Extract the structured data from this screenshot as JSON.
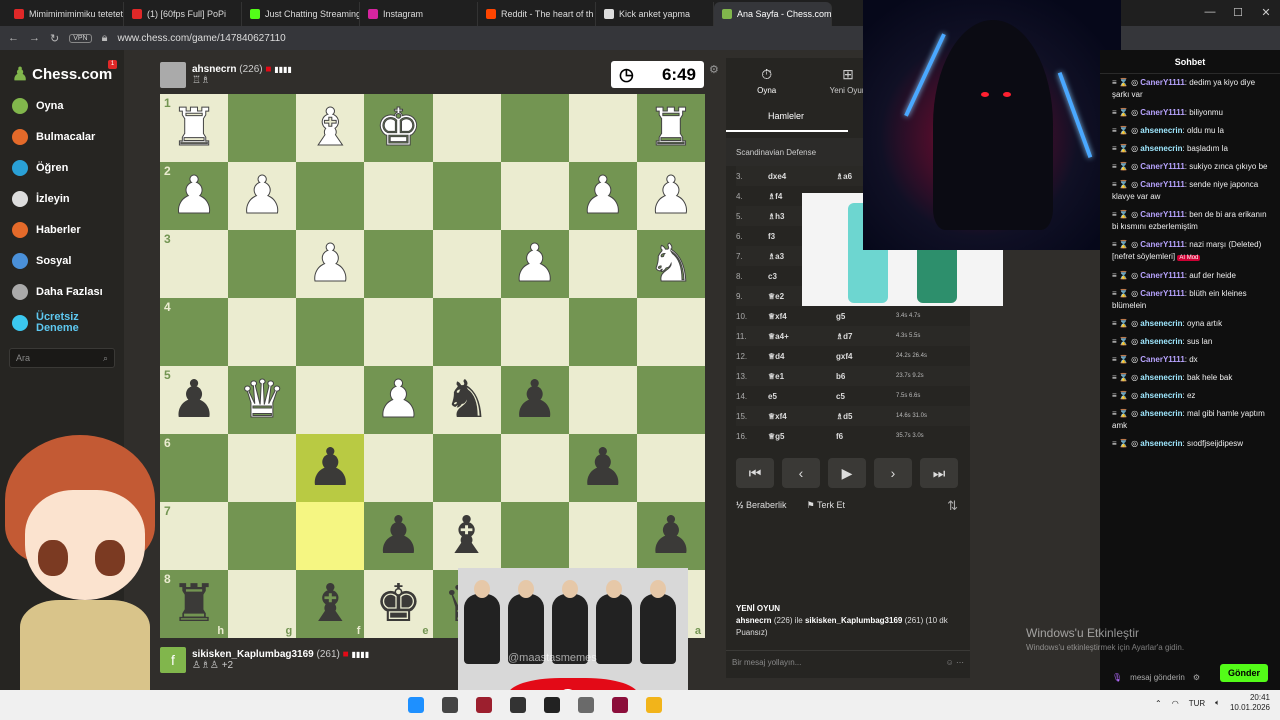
{
  "browser": {
    "tabs": [
      {
        "label": "Mimimimimimiku tetetete"
      },
      {
        "label": "(1) [60fps Full] PoPi"
      },
      {
        "label": "Just Chatting Streaming"
      },
      {
        "label": "Instagram"
      },
      {
        "label": "Reddit - The heart of th"
      },
      {
        "label": "Kick anket yapma"
      },
      {
        "label": "Ana Sayfa - Chess.com"
      }
    ],
    "url": "www.chess.com/game/147840627110",
    "vpn": "VPN",
    "kick_label": "kick."
  },
  "sidebar": {
    "logo": "Chess.com",
    "notif": "1",
    "items": [
      {
        "label": "Oyna",
        "icon": "play-icon",
        "color": "#81b64c"
      },
      {
        "label": "Bulmacalar",
        "icon": "puzzle-icon",
        "color": "#e46a2a"
      },
      {
        "label": "Öğren",
        "icon": "learn-icon",
        "color": "#2aa0d6"
      },
      {
        "label": "İzleyin",
        "icon": "watch-icon",
        "color": "#dddddd"
      },
      {
        "label": "Haberler",
        "icon": "news-icon",
        "color": "#e46a2a"
      },
      {
        "label": "Sosyal",
        "icon": "social-icon",
        "color": "#4a90d9"
      },
      {
        "label": "Daha Fazlası",
        "icon": "more-icon",
        "color": "#aaaaaa"
      },
      {
        "label": "Ücretsiz Deneme",
        "icon": "diamond-icon",
        "color": "#3bc8f0"
      }
    ],
    "search_placeholder": "Ara"
  },
  "top_player": {
    "name": "ahsnecrn",
    "rating": "(226)",
    "clock": "6:49"
  },
  "bottom_player": {
    "name": "sikisken_Kaplumbag3169",
    "rating": "(261)",
    "captured_extra": "+2",
    "badge": "f"
  },
  "board": {
    "ranks": [
      "1",
      "2",
      "3",
      "4",
      "5",
      "6",
      "7",
      "8"
    ],
    "files": [
      "h",
      "g",
      "f",
      "e",
      "d",
      "c",
      "b",
      "a"
    ]
  },
  "panel": {
    "tab_play": "Oyna",
    "tab_new": "Yeni Oyun",
    "subtab": "Hamleler",
    "opening": "Scandinavian Defense",
    "moves": [
      {
        "n": "3.",
        "w": "dxe4",
        "b": "♗a6",
        "t": ""
      },
      {
        "n": "4.",
        "w": "♗f4",
        "b": "",
        "t": ""
      },
      {
        "n": "5.",
        "w": "♗h3",
        "b": "",
        "t": ""
      },
      {
        "n": "6.",
        "w": "f3",
        "b": "",
        "t": ""
      },
      {
        "n": "7.",
        "w": "♗a3",
        "b": "",
        "t": ""
      },
      {
        "n": "8.",
        "w": "c3",
        "b": "",
        "t": ""
      },
      {
        "n": "9.",
        "w": "♕e2",
        "b": "",
        "t": ""
      },
      {
        "n": "10.",
        "w": "♕xf4",
        "b": "g5",
        "t": "3.4s 4.7s"
      },
      {
        "n": "11.",
        "w": "♕a4+",
        "b": "♗d7",
        "t": "4.3s 5.5s"
      },
      {
        "n": "12.",
        "w": "♕d4",
        "b": "gxf4",
        "t": "24.2s 26.4s"
      },
      {
        "n": "13.",
        "w": "♕e1",
        "b": "b6",
        "t": "23.7s 9.2s"
      },
      {
        "n": "14.",
        "w": "e5",
        "b": "c5",
        "t": "7.5s 6.6s"
      },
      {
        "n": "15.",
        "w": "♕xf4",
        "b": "♗d5",
        "t": "14.6s 31.0s"
      },
      {
        "n": "16.",
        "w": "♕g5",
        "b": "f6",
        "t": "35.7s 3.0s"
      }
    ],
    "draw": "Beraberlik",
    "resign": "Terk Et",
    "new_game_title": "YENİ OYUN",
    "new_game_p1": "ahsnecrn",
    "new_game_text1": "(226) ile",
    "new_game_p2": "sikisken_Kaplumbag3169",
    "new_game_text2": "(261) (10 dk Puansız)",
    "message_placeholder": "Bir mesaj yollayın..."
  },
  "chat": {
    "title": "Sohbet",
    "messages": [
      {
        "user": "CanerY1111",
        "cls": "cn1",
        "text": ": dedim ya kiyo diye şarkı var"
      },
      {
        "user": "CanerY1111",
        "cls": "cn1",
        "text": ": biliyonmu"
      },
      {
        "user": "ahsenecrin",
        "cls": "cn2",
        "text": ": oldu mu la"
      },
      {
        "user": "ahsenecrin",
        "cls": "cn2",
        "text": ": başladım la"
      },
      {
        "user": "CanerY1111",
        "cls": "cn1",
        "text": ": sukiyo zınca çıkıyo be"
      },
      {
        "user": "CanerY1111",
        "cls": "cn1",
        "text": ": sende niye japonca klavye var aw"
      },
      {
        "user": "CanerY1111",
        "cls": "cn1",
        "text": ": ben de bi ara erikanın bi kısmını ezberlemiştim"
      },
      {
        "user": "CanerY1111",
        "cls": "cn1",
        "text": ": nazi marşı (Deleted) [nefret söylemleri]"
      },
      {
        "user": "CanerY1111",
        "cls": "cn1",
        "text": ": auf der heide"
      },
      {
        "user": "CanerY1111",
        "cls": "cn1",
        "text": ": blüth ein kleines blümelein"
      },
      {
        "user": "ahsenecrin",
        "cls": "cn2",
        "text": ": oyna artık"
      },
      {
        "user": "ahsenecrin",
        "cls": "cn2",
        "text": ": sus lan"
      },
      {
        "user": "CanerY1111",
        "cls": "cn1",
        "text": ": dx"
      },
      {
        "user": "ahsenecrin",
        "cls": "cn2",
        "text": ": bak hele bak"
      },
      {
        "user": "ahsenecrin",
        "cls": "cn2",
        "text": ": ez"
      },
      {
        "user": "ahsenecrin",
        "cls": "cn2",
        "text": ": mal gibi hamle yaptım amk"
      },
      {
        "user": "ahsenecrin",
        "cls": "cn2",
        "text": ": sıodfjseijdipesw"
      }
    ],
    "mod_tag": "AI Mod",
    "input_label": "mesaj gönderin",
    "send": "Gönder"
  },
  "windows_watermark": {
    "line1": "Windows'u Etkinleştir",
    "line2": "Windows'u etkinleştirmek için Ayarlar'a gidin."
  },
  "taskbar": {
    "lang": "TUR",
    "time": "20:41",
    "date": "10.01.2026"
  },
  "meme_watermark": "@maastasmemes"
}
